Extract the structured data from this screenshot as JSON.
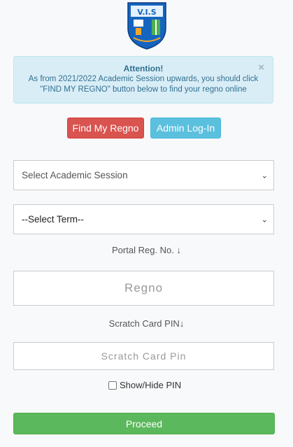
{
  "logo": {
    "crest_text": "V.I.S"
  },
  "alert": {
    "title": "Attention!",
    "line1": "As from 2021/2022 Academic Session upwards, you should click",
    "line2": "\"FIND MY REGNO\" button below to find your regno online",
    "close": "×"
  },
  "buttons": {
    "find_regno": "Find My Regno",
    "admin_login": "Admin Log-In"
  },
  "session_select": {
    "value": "Select Academic Session"
  },
  "term_select": {
    "value": "--Select Term--"
  },
  "regno": {
    "label": "Portal Reg. No. ↓",
    "placeholder": "Regno"
  },
  "pin": {
    "label": "Scratch Card PIN↓",
    "placeholder": "Scratch Card Pin"
  },
  "show_hide": {
    "label": "Show/Hide PIN"
  },
  "proceed": {
    "label": "Proceed"
  },
  "colors": {
    "danger": "#d9534f",
    "info": "#5bc0de",
    "success": "#5cb85c",
    "alert_bg": "#d9edf7"
  }
}
